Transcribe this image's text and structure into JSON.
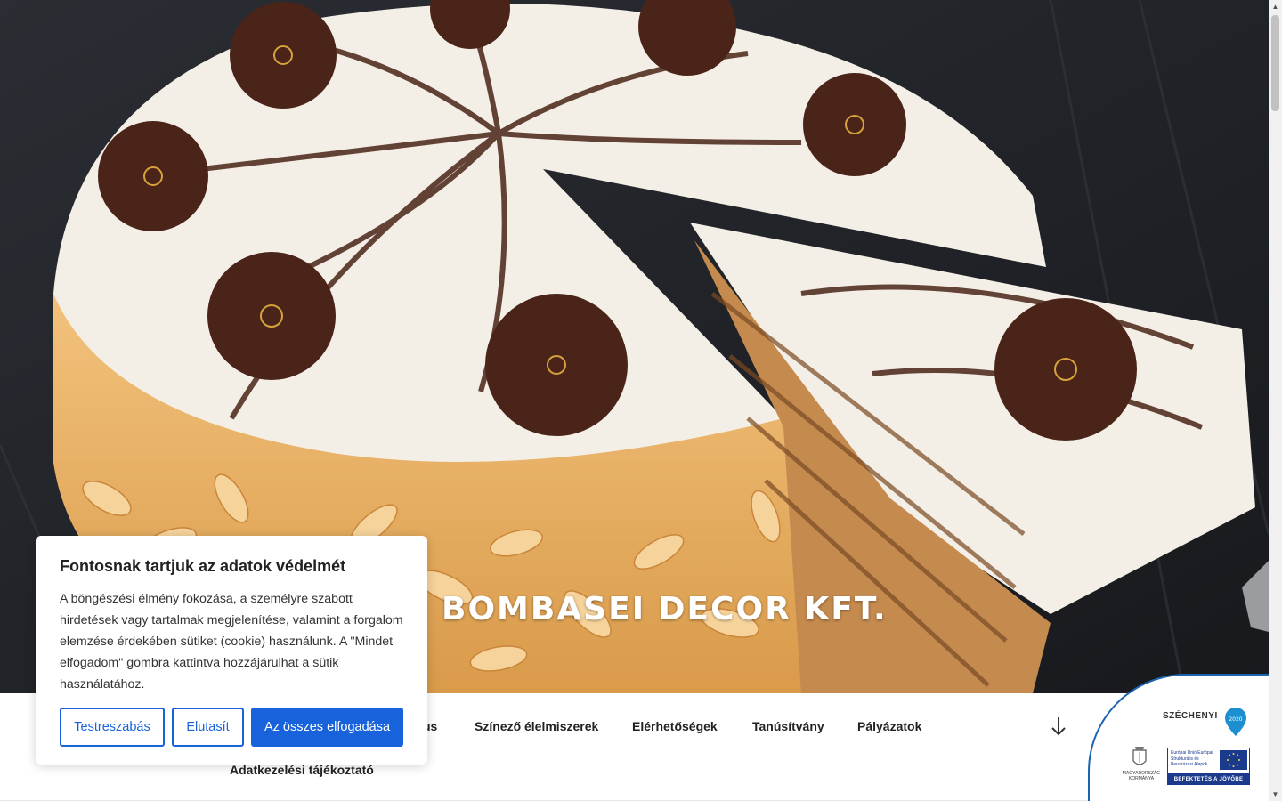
{
  "site": {
    "title": "BOMBASEI DECOR KFT."
  },
  "nav": {
    "items": [
      {
        "label": "us"
      },
      {
        "label": "Színező élelmiszerek"
      },
      {
        "label": "Elérhetőségek"
      },
      {
        "label": "Tanúsítvány"
      },
      {
        "label": "Pályázatok"
      },
      {
        "label": "Adatkezelési tájékoztató"
      }
    ]
  },
  "cookie": {
    "title": "Fontosnak tartjuk az adatok védelmét",
    "text": "A böngészési élmény fokozása, a személyre szabott hirdetések vagy tartalmak megjelenítése, valamint a forgalom elemzése érdekében sütiket (cookie) használunk. A \"Mindet elfogadom\" gombra kattintva hozzájárulhat a sütik használatához.",
    "customize_label": "Testreszabás",
    "reject_label": "Elutasít",
    "accept_all_label": "Az összes elfogadása"
  },
  "badge": {
    "title": "SZÉCHENYI",
    "year": "2020",
    "hu_text": "MAGYARORSZÁG KORMÁNYA",
    "eu_text": "Európai Unió Európai Strukturális és Beruházási Alapok",
    "bar_text": "BEFEKTETÉS A JÖVŐBE"
  },
  "colors": {
    "accent": "#1863dc",
    "badge_blue": "#1b3a8c",
    "hero_bg": "#1f2227",
    "cream": "#f4efe6",
    "chocolate": "#4a2418"
  }
}
